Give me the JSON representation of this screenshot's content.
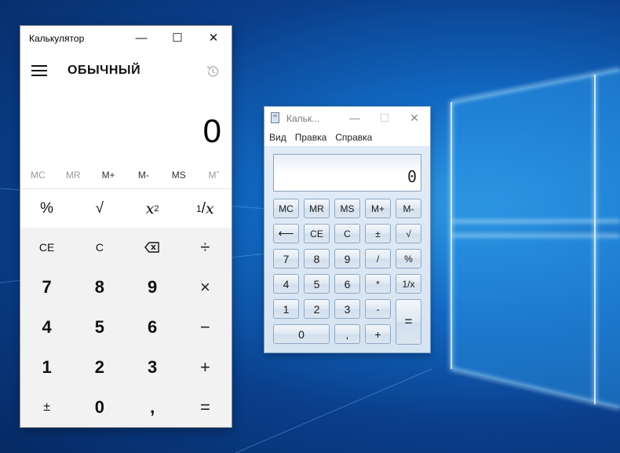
{
  "desktop": {
    "accent": "#1167c0"
  },
  "modern": {
    "title": "Калькулятор",
    "controls": {
      "minimize": "—",
      "maximize": "☐",
      "close": "✕"
    },
    "mode": "ОБЫЧНЫЙ",
    "display": "0",
    "memory": [
      "MC",
      "MR",
      "M+",
      "M-",
      "MS",
      "Mˇ"
    ],
    "sci": {
      "percent": "%",
      "sqrt": "√",
      "square_base": "x",
      "square_exp": "2",
      "recip_num": "1",
      "recip_sep": "/",
      "recip_den": "x"
    },
    "keys": [
      "CE",
      "C",
      "⌫",
      "÷",
      "7",
      "8",
      "9",
      "×",
      "4",
      "5",
      "6",
      "−",
      "1",
      "2",
      "3",
      "+",
      "±",
      "0",
      ",",
      "="
    ]
  },
  "classic": {
    "title": "Кальк...",
    "menu": [
      "Вид",
      "Правка",
      "Справка"
    ],
    "display": "0",
    "buttons": {
      "mc": "MC",
      "mr": "MR",
      "ms": "MS",
      "mplus": "M+",
      "mminus": "M-",
      "back": "⟵",
      "ce": "CE",
      "c": "C",
      "plusminus": "±",
      "sqrt": "√",
      "d7": "7",
      "d8": "8",
      "d9": "9",
      "div": "/",
      "pct": "%",
      "d4": "4",
      "d5": "5",
      "d6": "6",
      "mul": "*",
      "recip": "1/x",
      "d1": "1",
      "d2": "2",
      "d3": "3",
      "minus": "-",
      "eq": "=",
      "d0": "0",
      "comma": ",",
      "plus": "+"
    }
  }
}
